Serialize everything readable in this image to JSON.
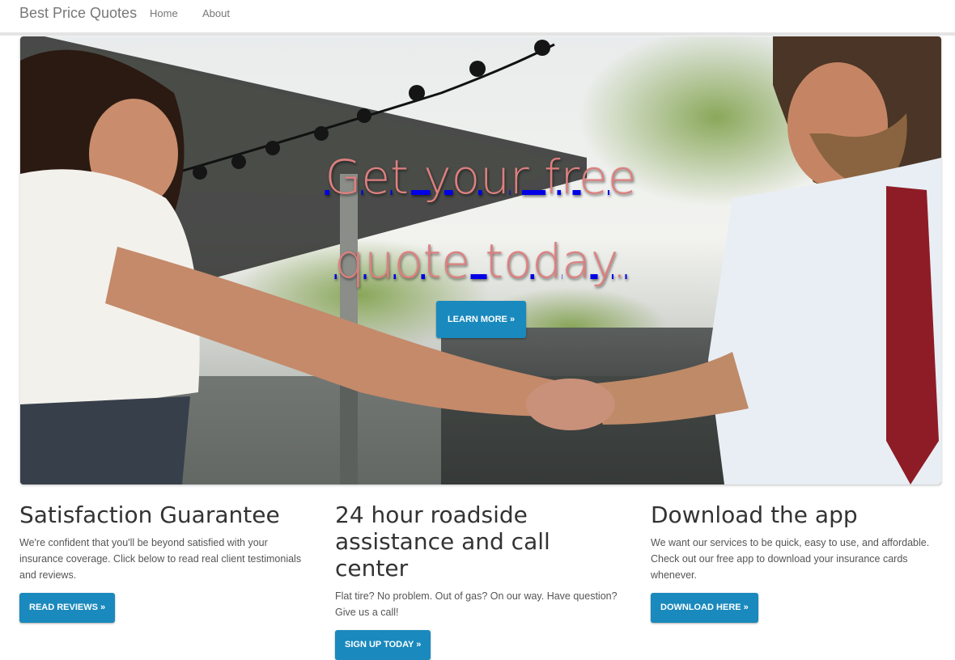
{
  "navbar": {
    "brand": "Best Price Quotes",
    "links": [
      {
        "label": "Home"
      },
      {
        "label": "About"
      }
    ]
  },
  "hero": {
    "title_line1": "Get your free",
    "title_line2": "quote today.",
    "button_label": "LEARN MORE »",
    "title_color": "#de7f7f",
    "underline_color": "#0000e6"
  },
  "features": [
    {
      "heading": "Satisfaction Guarantee",
      "body": "We're confident that you'll be beyond satisfied with your insurance coverage. Click below to read real client testimonials and reviews.",
      "button_label": "READ REVIEWS »"
    },
    {
      "heading": "24 hour roadside assistance and call center",
      "body": "Flat tire? No problem. Out of gas? On our way. Have question? Give us a call!",
      "button_label": "SIGN UP TODAY »"
    },
    {
      "heading": "Download the app",
      "body": "We want our services to be quick, easy to use, and affordable. Check out our free app to download your insurance cards whenever.",
      "button_label": "DOWNLOAD HERE »"
    }
  ],
  "colors": {
    "button": "#1a89bd",
    "nav_text": "#777777"
  }
}
